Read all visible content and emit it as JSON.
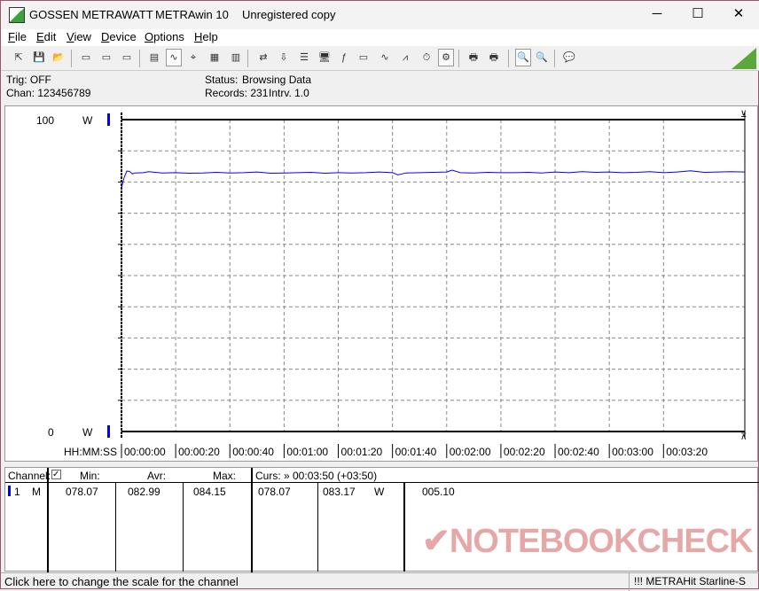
{
  "titlebar": {
    "brand": "GOSSEN METRAWATT",
    "app": "METRAwin 10",
    "license": "Unregistered copy",
    "minimize": "─",
    "maximize": "☐",
    "close": "✕"
  },
  "menu": [
    "File",
    "Edit",
    "View",
    "Device",
    "Options",
    "Help"
  ],
  "toolbar": {
    "icons": [
      "export-icon",
      "save-icon",
      "open-icon",
      "device-read-icon",
      "device-clear-icon",
      "device-memory-icon",
      "display-icon",
      "graph-view-icon",
      "crosshair-icon",
      "table-view-icon",
      "histogram-icon",
      "transfer-icon",
      "download-icon",
      "list-icon",
      "monitor-icon",
      "function-icon",
      "memory-icon",
      "signal-icon",
      "waveform-icon",
      "timer-icon",
      "trigger-icon",
      "print-preview-icon",
      "print-icon",
      "zoom-signal-icon",
      "zoom-icon",
      "message-icon"
    ]
  },
  "info": {
    "trig": "Trig: OFF",
    "chan": "Chan:  123456789",
    "status_label": "Status:",
    "status": "Browsing Data",
    "records": "Records: 231",
    "interval": "Intrv. 1.0"
  },
  "chart_data": {
    "type": "line",
    "title": "",
    "xlabel": "HH:MM:SS",
    "ylabel": "W",
    "ylim": [
      0,
      100
    ],
    "xlim": [
      0,
      230
    ],
    "y_top_label": "100",
    "y_bottom_label": "0",
    "y_unit": "W",
    "x_ticks": [
      "00:00:00",
      "00:00:20",
      "00:00:40",
      "00:01:00",
      "00:01:20",
      "00:01:40",
      "00:02:00",
      "00:02:20",
      "00:02:40",
      "00:03:00",
      "00:03:20"
    ],
    "series": [
      {
        "name": "Channel 1",
        "color": "#0000ff",
        "x": [
          0,
          1,
          2,
          3,
          4,
          5,
          8,
          10,
          15,
          20,
          25,
          30,
          35,
          40,
          45,
          50,
          55,
          60,
          65,
          70,
          75,
          80,
          85,
          90,
          95,
          100,
          102,
          105,
          110,
          115,
          120,
          122,
          125,
          130,
          135,
          140,
          145,
          150,
          155,
          160,
          165,
          170,
          175,
          180,
          185,
          190,
          195,
          200,
          205,
          210,
          215,
          220,
          225,
          230
        ],
        "y": [
          78.1,
          81.5,
          83.5,
          83.4,
          82.6,
          82.9,
          83.0,
          83.3,
          82.9,
          83.0,
          82.8,
          82.9,
          83.1,
          82.9,
          83.0,
          83.2,
          82.8,
          82.9,
          83.0,
          83.1,
          82.8,
          83.0,
          82.9,
          83.0,
          83.2,
          83.0,
          82.3,
          82.9,
          83.0,
          83.1,
          83.2,
          83.8,
          83.0,
          82.9,
          83.1,
          83.0,
          83.0,
          83.1,
          82.9,
          83.2,
          83.0,
          83.3,
          83.1,
          83.2,
          83.0,
          83.1,
          83.3,
          83.0,
          83.2,
          83.6,
          83.1,
          83.2,
          83.3,
          83.2
        ]
      }
    ]
  },
  "table": {
    "channel_header": "Channel:",
    "min_header": "Min:",
    "avr_header": "Avr:",
    "max_header": "Max:",
    "cursor_header": "Curs: » 00:03:50 (+03:50)",
    "rows": [
      {
        "channel": "1",
        "mode": "M",
        "min": "078.07",
        "avr": "082.99",
        "max": "084.15",
        "curs_min": "078.07",
        "curs_val": "083.17",
        "unit": "W",
        "extra": "005.10"
      }
    ]
  },
  "statusbar": {
    "hint": "Click here to change the scale for the channel",
    "device": "!!! METRAHit Starline-S"
  },
  "watermark": "NOTEBOOKCHECK"
}
